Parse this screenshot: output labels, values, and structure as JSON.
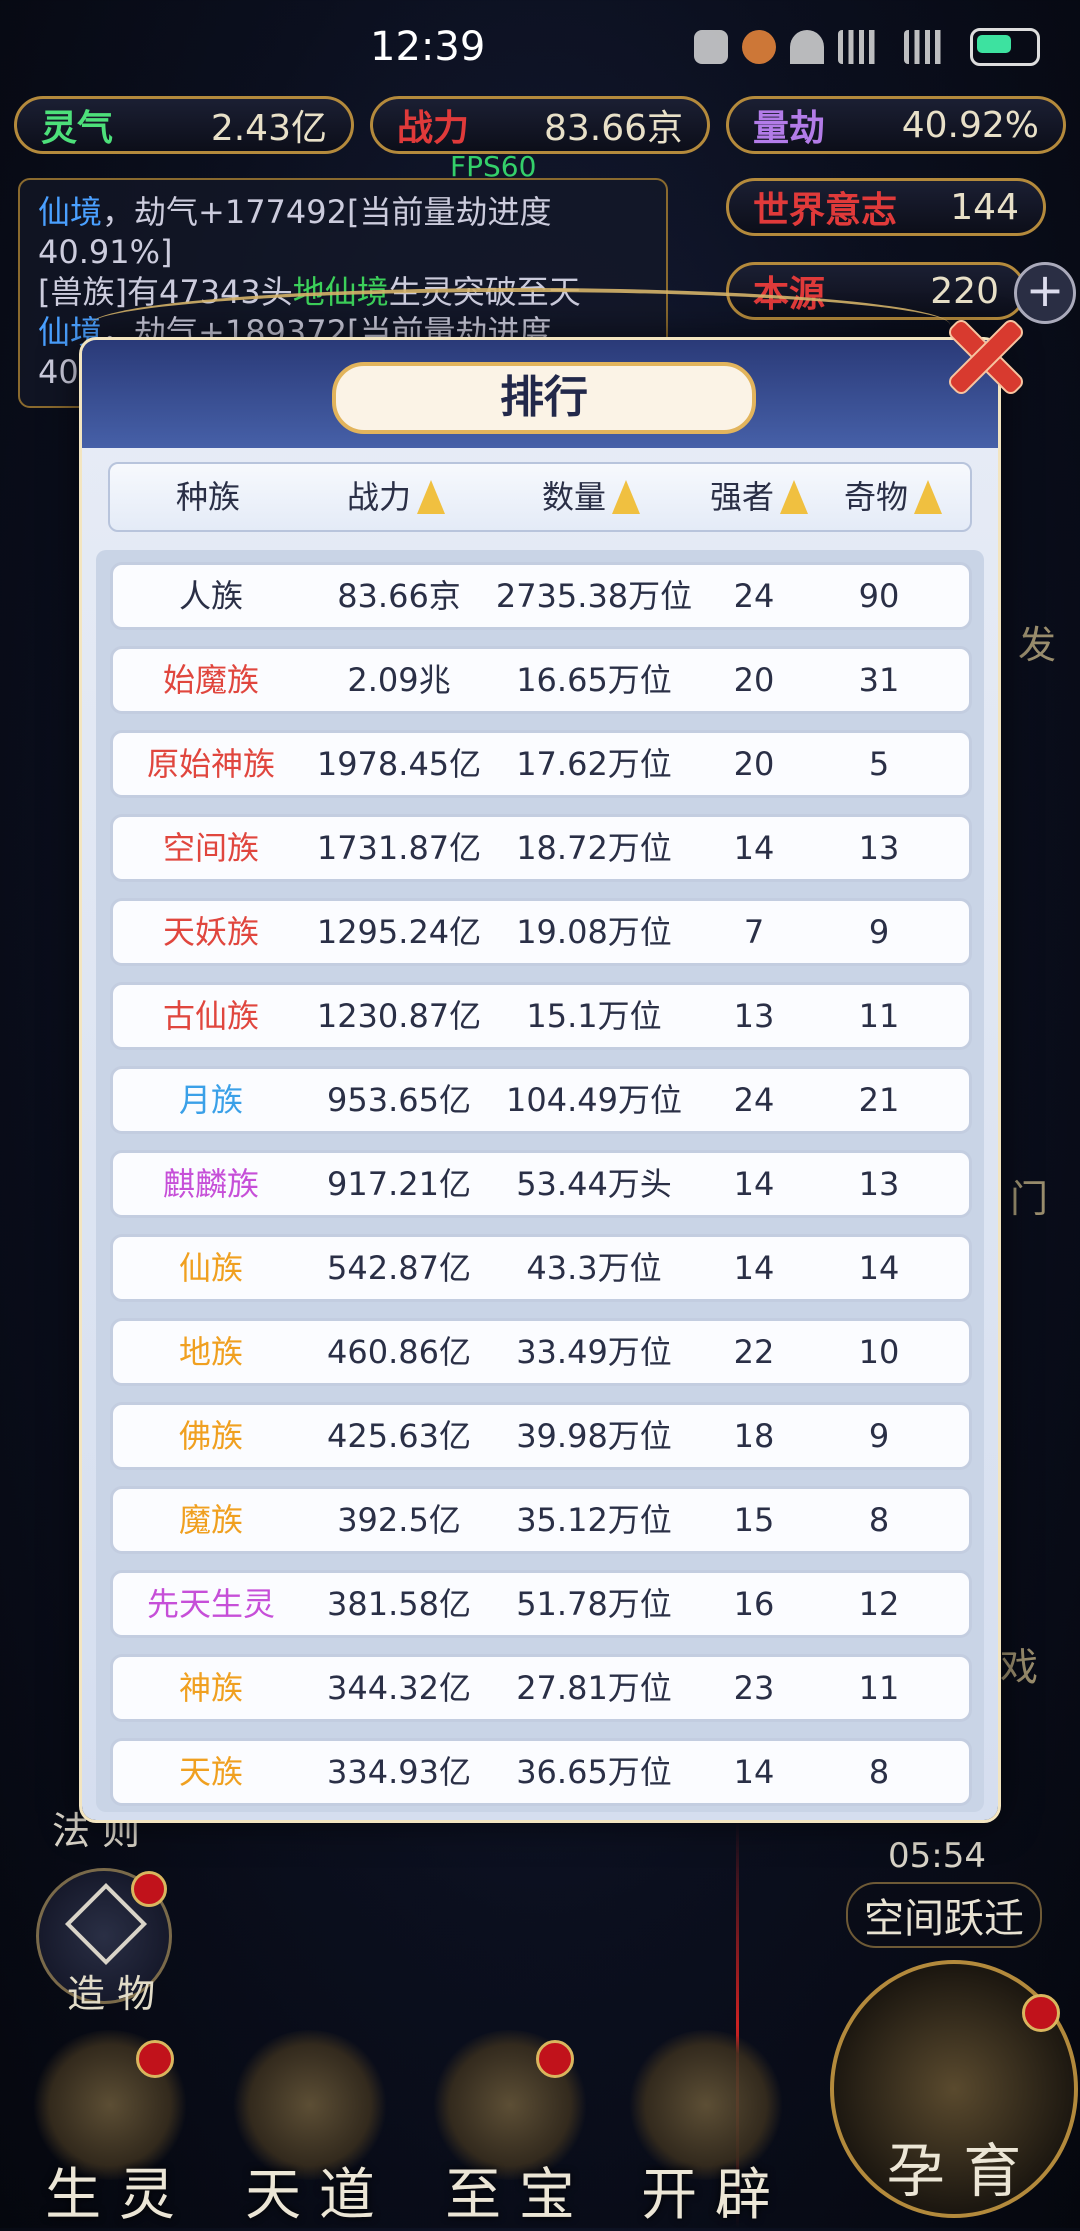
{
  "status_bar": {
    "time": "12:39"
  },
  "resources": {
    "lingqi": {
      "label": "灵气",
      "value": "2.43亿"
    },
    "zhanli": {
      "label": "战力",
      "value": "83.66京"
    },
    "liangjie": {
      "label": "量劫",
      "value": "40.92%"
    },
    "world_will": {
      "label": "世界意志",
      "value": "144"
    },
    "benyuan": {
      "label": "本源",
      "value": "220"
    }
  },
  "fps": "FPS60",
  "log": {
    "line1_hl": "仙境",
    "line1_rest": "，劫气+177492[当前量劫进度40.91%]",
    "line2_prefix": "[兽族]有47343头",
    "line2_hl": "地仙境",
    "line2_rest": "生灵突破至天",
    "line3_hl": "仙境",
    "line3_rest": "，劫气+189372[当前量劫进度",
    "line4": "40"
  },
  "modal": {
    "title": "排行",
    "headers": [
      "种族",
      "战力",
      "数量",
      "强者",
      "奇物"
    ]
  },
  "rows": [
    {
      "race": "人族",
      "power": "83.66京",
      "count": "2735.38万位",
      "strong": "24",
      "items": "90",
      "color": "#2a2f46"
    },
    {
      "race": "始魔族",
      "power": "2.09兆",
      "count": "16.65万位",
      "strong": "20",
      "items": "31",
      "color": "#e0463e"
    },
    {
      "race": "原始神族",
      "power": "1978.45亿",
      "count": "17.62万位",
      "strong": "20",
      "items": "5",
      "color": "#e0463e"
    },
    {
      "race": "空间族",
      "power": "1731.87亿",
      "count": "18.72万位",
      "strong": "14",
      "items": "13",
      "color": "#e0463e"
    },
    {
      "race": "天妖族",
      "power": "1295.24亿",
      "count": "19.08万位",
      "strong": "7",
      "items": "9",
      "color": "#e0463e"
    },
    {
      "race": "古仙族",
      "power": "1230.87亿",
      "count": "15.1万位",
      "strong": "13",
      "items": "11",
      "color": "#e0463e"
    },
    {
      "race": "月族",
      "power": "953.65亿",
      "count": "104.49万位",
      "strong": "24",
      "items": "21",
      "color": "#3aa0e8"
    },
    {
      "race": "麒麟族",
      "power": "917.21亿",
      "count": "53.44万头",
      "strong": "14",
      "items": "13",
      "color": "#c64fd8"
    },
    {
      "race": "仙族",
      "power": "542.87亿",
      "count": "43.3万位",
      "strong": "14",
      "items": "14",
      "color": "#f0a020"
    },
    {
      "race": "地族",
      "power": "460.86亿",
      "count": "33.49万位",
      "strong": "22",
      "items": "10",
      "color": "#f0a020"
    },
    {
      "race": "佛族",
      "power": "425.63亿",
      "count": "39.98万位",
      "strong": "18",
      "items": "9",
      "color": "#f0a020"
    },
    {
      "race": "魔族",
      "power": "392.5亿",
      "count": "35.12万位",
      "strong": "15",
      "items": "8",
      "color": "#f0a020"
    },
    {
      "race": "先天生灵",
      "power": "381.58亿",
      "count": "51.78万位",
      "strong": "16",
      "items": "12",
      "color": "#c64fd8"
    },
    {
      "race": "神族",
      "power": "344.32亿",
      "count": "27.81万位",
      "strong": "23",
      "items": "11",
      "color": "#f0a020"
    },
    {
      "race": "天族",
      "power": "334.93亿",
      "count": "36.65万位",
      "strong": "14",
      "items": "8",
      "color": "#f0a020"
    }
  ],
  "side": {
    "timer": "05:54",
    "leap": "空间跃迁",
    "rule": "法 则",
    "make": "造 物",
    "fa": "发",
    "men": "门",
    "xi": "戏"
  },
  "bottom_nav": {
    "shengling": "生 灵",
    "tiandao": "天 道",
    "zhibao": "至 宝",
    "kaipi": "开 辟",
    "yunyu": "孕 育"
  }
}
